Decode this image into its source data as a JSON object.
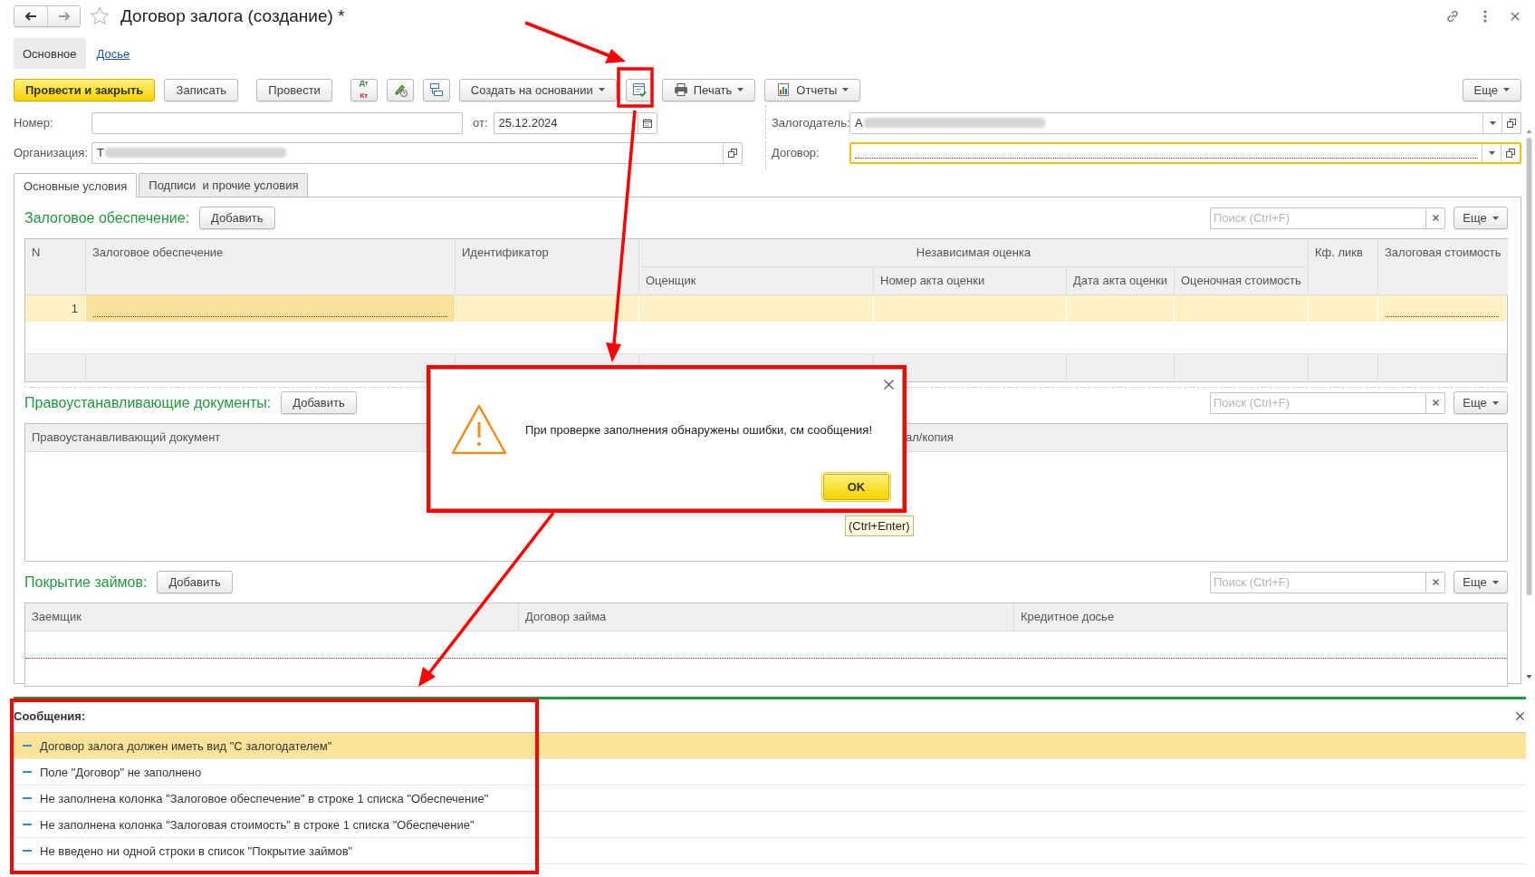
{
  "window": {
    "title": "Договор залога (создание) *"
  },
  "nav_tabs": [
    {
      "label": "Основное",
      "selected": true
    },
    {
      "label": "Досье",
      "selected": false
    }
  ],
  "toolbar": {
    "items": [
      {
        "kind": "primary",
        "label": "Провести и закрыть"
      },
      {
        "kind": "button",
        "label": "Записать"
      },
      {
        "kind": "button",
        "label": "Провести"
      },
      {
        "kind": "icon",
        "labels": [
          "Дт",
          "Кт"
        ]
      },
      {
        "kind": "icon"
      },
      {
        "kind": "icon"
      },
      {
        "kind": "menu",
        "label": "Создать на основании"
      },
      {
        "kind": "icon"
      },
      {
        "kind": "menu",
        "label": "Печать"
      },
      {
        "kind": "menu",
        "label": "Отчеты"
      }
    ],
    "more": "Еще"
  },
  "header": {
    "number": {
      "label": "Номер:"
    },
    "date": {
      "label": "от:",
      "value": "25.12.2024"
    },
    "organization": {
      "label": "Организация:",
      "value": "Т",
      "blurred": true
    },
    "pledger": {
      "label": "Залогодатель:",
      "value": "А",
      "blurred": true
    },
    "contract": {
      "label": "Договор:",
      "focused": true,
      "invalid": true
    }
  },
  "form_tabs": [
    {
      "label": "Основные условия",
      "selected": true
    },
    {
      "label": "Подписи  и прочие условия",
      "selected": false
    }
  ],
  "sections": [
    {
      "title": "Залоговое обеспечение:",
      "add": "Добавить",
      "search_placeholder": "Поиск (Ctrl+F)",
      "more": "Еще",
      "table": {
        "columns": [
          {
            "label": "N"
          },
          {
            "label": "Залоговое обеспечение"
          },
          {
            "label": "Идентификатор"
          },
          {
            "label": "Независимая оценка",
            "children": [
              {
                "label": "Оценщик"
              },
              {
                "label": "Номер акта оценки"
              },
              {
                "label": "Дата акта оценки"
              },
              {
                "label": "Оценочная стоимость"
              }
            ]
          },
          {
            "label": "Кф. ликв"
          },
          {
            "label": "Залоговая стоимость"
          }
        ],
        "rows": [
          {
            "selected": true,
            "cells": [
              {
                "text": "1",
                "current": false,
                "invalid": false
              },
              {
                "current": true,
                "invalid": true
              },
              {
                "current": false,
                "invalid": false
              },
              {
                "current": false,
                "invalid": false
              },
              {
                "current": false,
                "invalid": false
              },
              {
                "current": false,
                "invalid": false
              },
              {
                "current": false,
                "invalid": false
              },
              {
                "current": false,
                "invalid": false
              },
              {
                "current": false,
                "invalid": true
              }
            ]
          }
        ],
        "footer": true,
        "invalid": false
      }
    },
    {
      "title": "Правоустанавливающие документы:",
      "add": "Добавить",
      "search_placeholder": "Поиск (Ctrl+F)",
      "more": "Еще",
      "table": {
        "columns": [
          {
            "label": "Правоустанавливающий документ"
          },
          {
            "label": "ал/копия"
          }
        ],
        "footer": false,
        "invalid": false
      }
    },
    {
      "title": "Покрытие займов:",
      "add": "Добавить",
      "search_placeholder": "Поиск (Ctrl+F)",
      "more": "Еще",
      "table": {
        "columns": [
          {
            "label": "Заемщик"
          },
          {
            "label": "Договор займа"
          },
          {
            "label": "Кредитное досье"
          }
        ],
        "footer": false,
        "invalid": true
      }
    }
  ],
  "messages": {
    "title": "Сообщения:",
    "items": [
      {
        "text": "Договор залога должен иметь вид \"С залогодателем\"",
        "selected": true
      },
      {
        "text": "Поле \"Договор\" не заполнено",
        "selected": false
      },
      {
        "text": "Не заполнена колонка \"Залоговое обеспечение\" в строке 1 списка \"Обеспечение\"",
        "selected": false
      },
      {
        "text": "Не заполнена колонка \"Залоговая стоимость\" в строке 1 списка \"Обеспечение\"",
        "selected": false
      },
      {
        "text": "Не введено ни одной строки в список \"Покрытие займов\"",
        "selected": false
      }
    ]
  },
  "dialog": {
    "message": "При проверке заполнения обнаружены ошибки, см сообщения!",
    "ok": "OK",
    "tooltip": "(Ctrl+Enter)"
  }
}
